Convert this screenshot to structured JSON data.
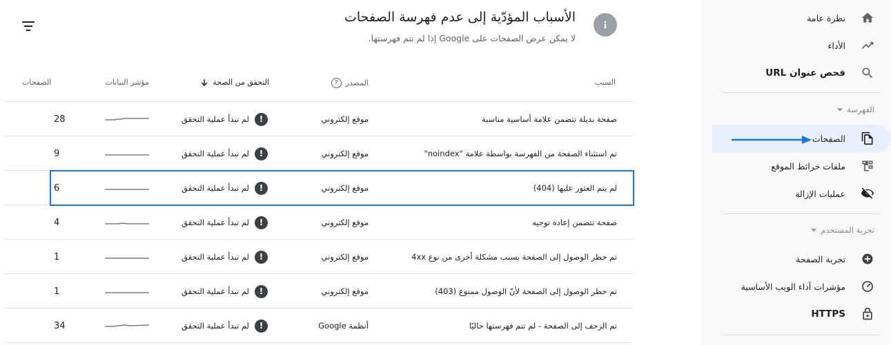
{
  "header": {
    "title": "الأسباب المؤدّية إلى عدم فهرسة الصفحات",
    "subtitle": "لا يمكن عرض الصفحات على Google إذا لم تتم فهرستها."
  },
  "sidebar": {
    "top_items": [
      {
        "label": "نظرة عامة",
        "icon": "home-icon"
      },
      {
        "label": "الأداء",
        "icon": "trending-up-icon"
      },
      {
        "label": "فحص عنوان URL",
        "icon": "search-icon"
      }
    ],
    "indexing_section": "الفهرسة",
    "indexing_items": [
      {
        "label": "الصفحات",
        "icon": "pages-icon",
        "active": true
      },
      {
        "label": "ملفات خرائط الموقع",
        "icon": "sitemap-icon"
      },
      {
        "label": "عمليات الإزالة",
        "icon": "removals-icon"
      }
    ],
    "experience_section": "تجربة المستخدم",
    "experience_items": [
      {
        "label": "تجربة الصفحة",
        "icon": "page-experience-icon"
      },
      {
        "label": "مؤشرات أداء الويب الأساسية",
        "icon": "speed-gauge-icon"
      },
      {
        "label": "HTTPS",
        "icon": "lock-icon"
      }
    ]
  },
  "table": {
    "columns": {
      "reason": "السبب",
      "source": "المصدر",
      "validation": "التحقق من الصحة",
      "trend": "مؤشر البيانات",
      "pages": "الصفحات"
    },
    "rows": [
      {
        "reason": "صفحة بديلة تتضمن علامة أساسية مناسبة",
        "source": "موقع إلكتروني",
        "validation": "لم تبدأ عملية التحقق",
        "pages": "28",
        "bold": false
      },
      {
        "reason": "تم استثناء الصفحة من الفهرسة بواسطة علامة \"noindex\"",
        "source": "موقع إلكتروني",
        "validation": "لم تبدأ عملية التحقق",
        "pages": "9",
        "bold": false
      },
      {
        "reason": "لم يتم العثور عليها (404)",
        "source": "موقع إلكتروني",
        "validation": "لم تبدأ عملية التحقق",
        "pages": "6",
        "bold": false
      },
      {
        "reason": "صفحة تتضمن إعادة توجيه",
        "source": "موقع إلكتروني",
        "validation": "لم تبدأ عملية التحقق",
        "pages": "4",
        "bold": false
      },
      {
        "reason": "تم حظر الوصول إلى الصفحة بسبب مشكلة أخرى من نوع 4xx",
        "source": "موقع إلكتروني",
        "validation": "لم تبدأ عملية التحقق",
        "pages": "1",
        "bold": false
      },
      {
        "reason": "تم حظر الوصول إلى الصفحة لأنّ الوصول ممنوع (403)",
        "source": "موقع إلكتروني",
        "validation": "لم تبدأ عملية التحقق",
        "pages": "1",
        "bold": false
      },
      {
        "reason": "تم الزحف إلى الصفحة - لم تتم فهرستها حاليًا",
        "source": "أنظمة Google",
        "validation": "لم تبدأ عملية التحقق",
        "pages": "34",
        "bold": false
      }
    ]
  },
  "colors": {
    "accent": "#1a73e8",
    "active_bg": "#e8f0fe",
    "sidebar_bg": "#f8f9fa"
  }
}
